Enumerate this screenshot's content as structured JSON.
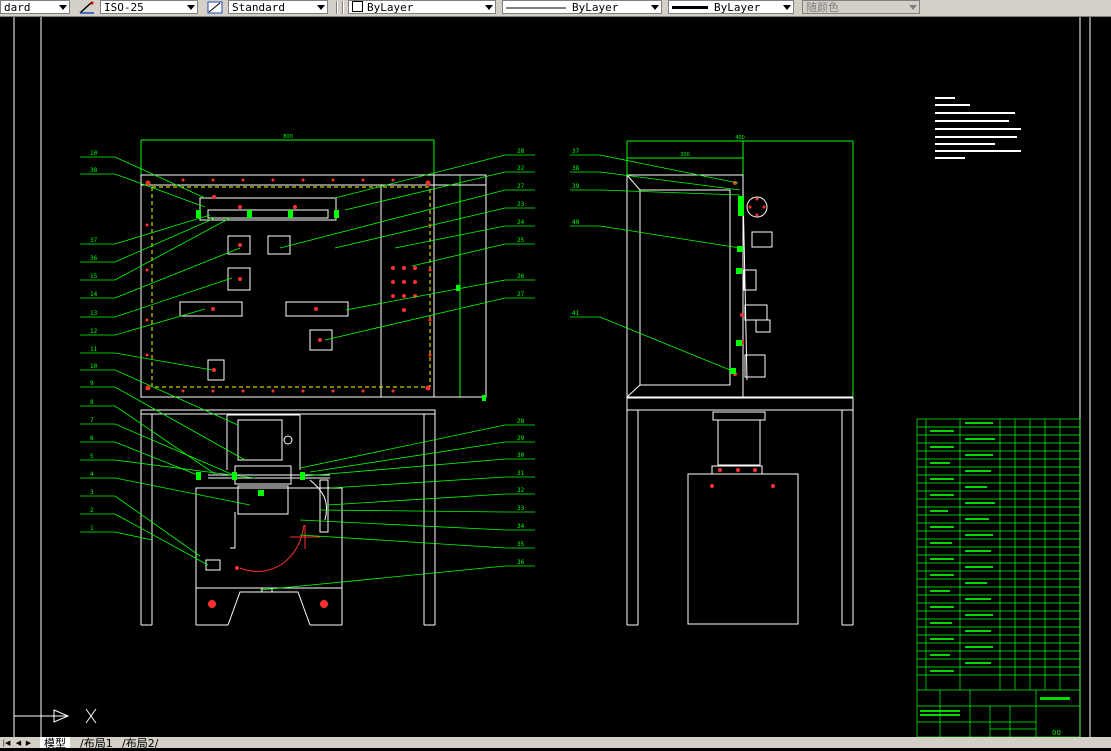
{
  "toolbar": {
    "text_style": "dard",
    "dim_style": "ISO-25",
    "table_style": "Standard",
    "layer_color": "ByLayer",
    "linetype": "ByLayer",
    "lineweight": "ByLayer",
    "plot_style": "随颜色"
  },
  "tabs": {
    "model": "模型",
    "layout1": "布局1",
    "layout2": "布局2"
  },
  "drawing": {
    "front_top_dim": "800",
    "side_top_dim": "400",
    "side_inner_dim": "300",
    "left_labels": [
      "10",
      "38",
      "37",
      "36",
      "15",
      "14",
      "13",
      "12",
      "11",
      "10",
      "9",
      "8",
      "7",
      "6",
      "5",
      "4",
      "3",
      "2",
      "1"
    ],
    "mid_labels": [
      "28",
      "22",
      "27",
      "23",
      "24",
      "25",
      "26",
      "27",
      "28",
      "29",
      "30",
      "31",
      "32",
      "33",
      "34",
      "35",
      "36"
    ],
    "side_labels": [
      "37",
      "38",
      "39",
      "40",
      "41"
    ],
    "title_block_code": "00"
  },
  "colors": {
    "background": "#000000",
    "lines": "#ffffff",
    "leaders": "#00ff00",
    "markers": "#ff0000",
    "dashed": "#ffff00"
  }
}
